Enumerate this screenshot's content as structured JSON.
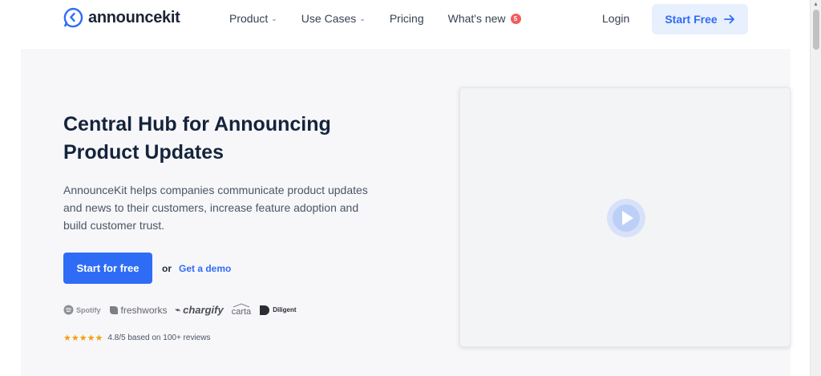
{
  "nav": {
    "logo_text": "announcekit",
    "items": [
      {
        "label": "Product",
        "chevron": true
      },
      {
        "label": "Use Cases",
        "chevron": true
      },
      {
        "label": "Pricing",
        "chevron": false
      },
      {
        "label": "What's new",
        "chevron": false,
        "badge": "5"
      }
    ],
    "login_label": "Login",
    "start_label": "Start Free",
    "accent": "#2f6cf6"
  },
  "hero": {
    "headline_line1": "Central Hub for Announcing",
    "headline_line2": "Product Updates",
    "description": "AnnounceKit helps companies communicate product updates and news to their customers, increase feature adoption and build customer trust.",
    "cta_label": "Start for free",
    "or_text": "or",
    "demo_label": "Get a demo",
    "brands": [
      "Spotify",
      "freshworks",
      "chargify",
      "carta",
      "Diligent"
    ],
    "stars": "★★★★★",
    "rating_text": "4.8/5 based on 100+ reviews"
  },
  "icons": {
    "logo": "announcekit-logo-icon",
    "arrow": "arrow-right-icon",
    "play": "play-icon"
  }
}
